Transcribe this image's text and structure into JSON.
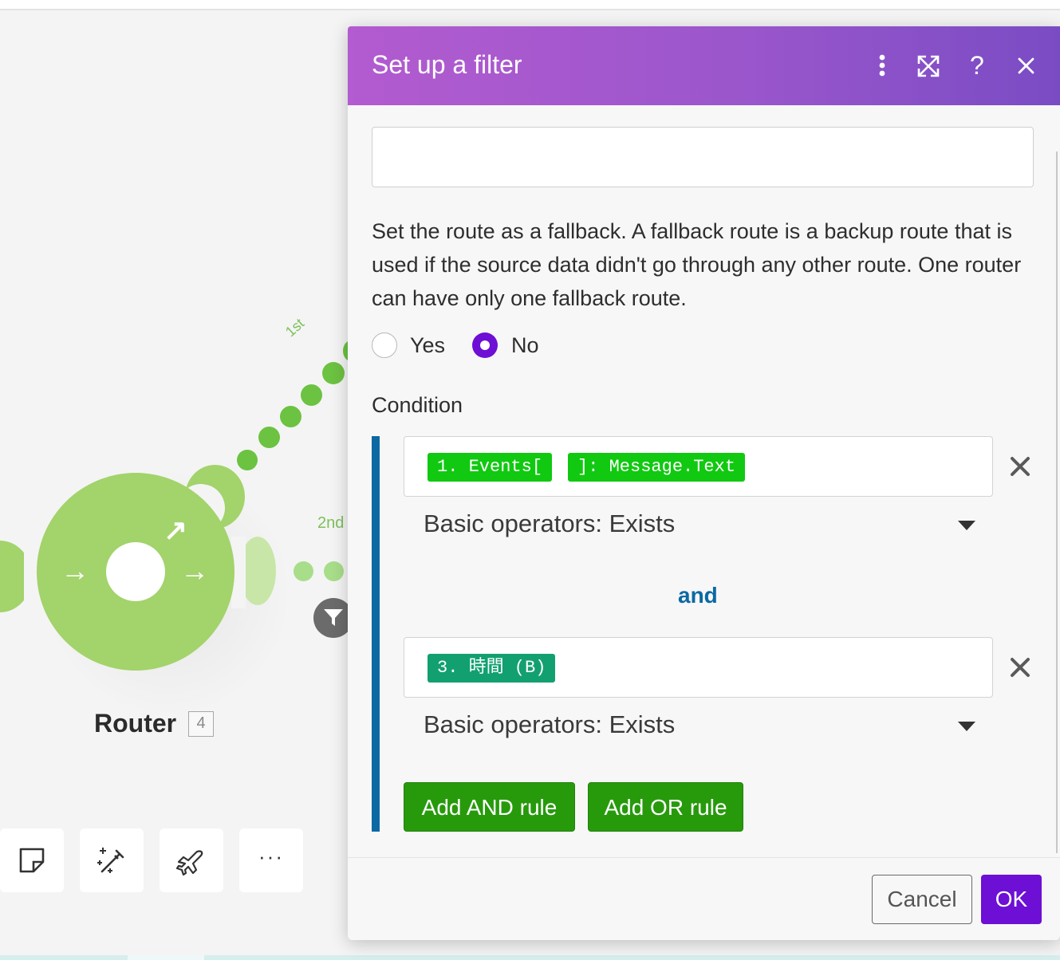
{
  "scenario": {
    "module_name": "Router",
    "module_badge": "4",
    "route_labels": [
      "1st",
      "2nd"
    ],
    "toolbar": [
      {
        "icon": "note-icon"
      },
      {
        "icon": "magic-wand-icon"
      },
      {
        "icon": "airplane-icon"
      },
      {
        "icon": "more-icon",
        "label": "···"
      }
    ]
  },
  "dialog": {
    "title": "Set up a filter",
    "header_icons": [
      "kebab-menu-icon",
      "expand-icon",
      "help-icon",
      "close-icon"
    ],
    "help_label": "?",
    "label_field": {
      "value": "",
      "placeholder": ""
    },
    "fallback": {
      "text": "Set the route as a fallback. A fallback route is a backup route that is used if the source data didn't go through any other route. One router can have only one fallback route.",
      "options": [
        "Yes",
        "No"
      ],
      "selected": "No"
    },
    "condition": {
      "heading": "Condition",
      "rules": [
        {
          "operand_tokens": [
            "1. Events[",
            "]: Message.Text"
          ],
          "token_color": "#10c910",
          "operator": "Basic operators: Exists"
        },
        {
          "operand_tokens": [
            "3. 時間 (B)"
          ],
          "token_color": "#12a070",
          "operator": "Basic operators: Exists"
        }
      ],
      "joiner": "and",
      "add_and": "Add AND rule",
      "add_or": "Add OR rule"
    },
    "footer": {
      "cancel": "Cancel",
      "ok": "OK"
    }
  },
  "colors": {
    "header_gradient_start": "#b35bd0",
    "header_gradient_end": "#7a4cc4",
    "primary": "#6d0fd4",
    "add_rule_green": "#279a0c",
    "condition_bar": "#0b69a3",
    "router_green": "#a3d36b"
  }
}
